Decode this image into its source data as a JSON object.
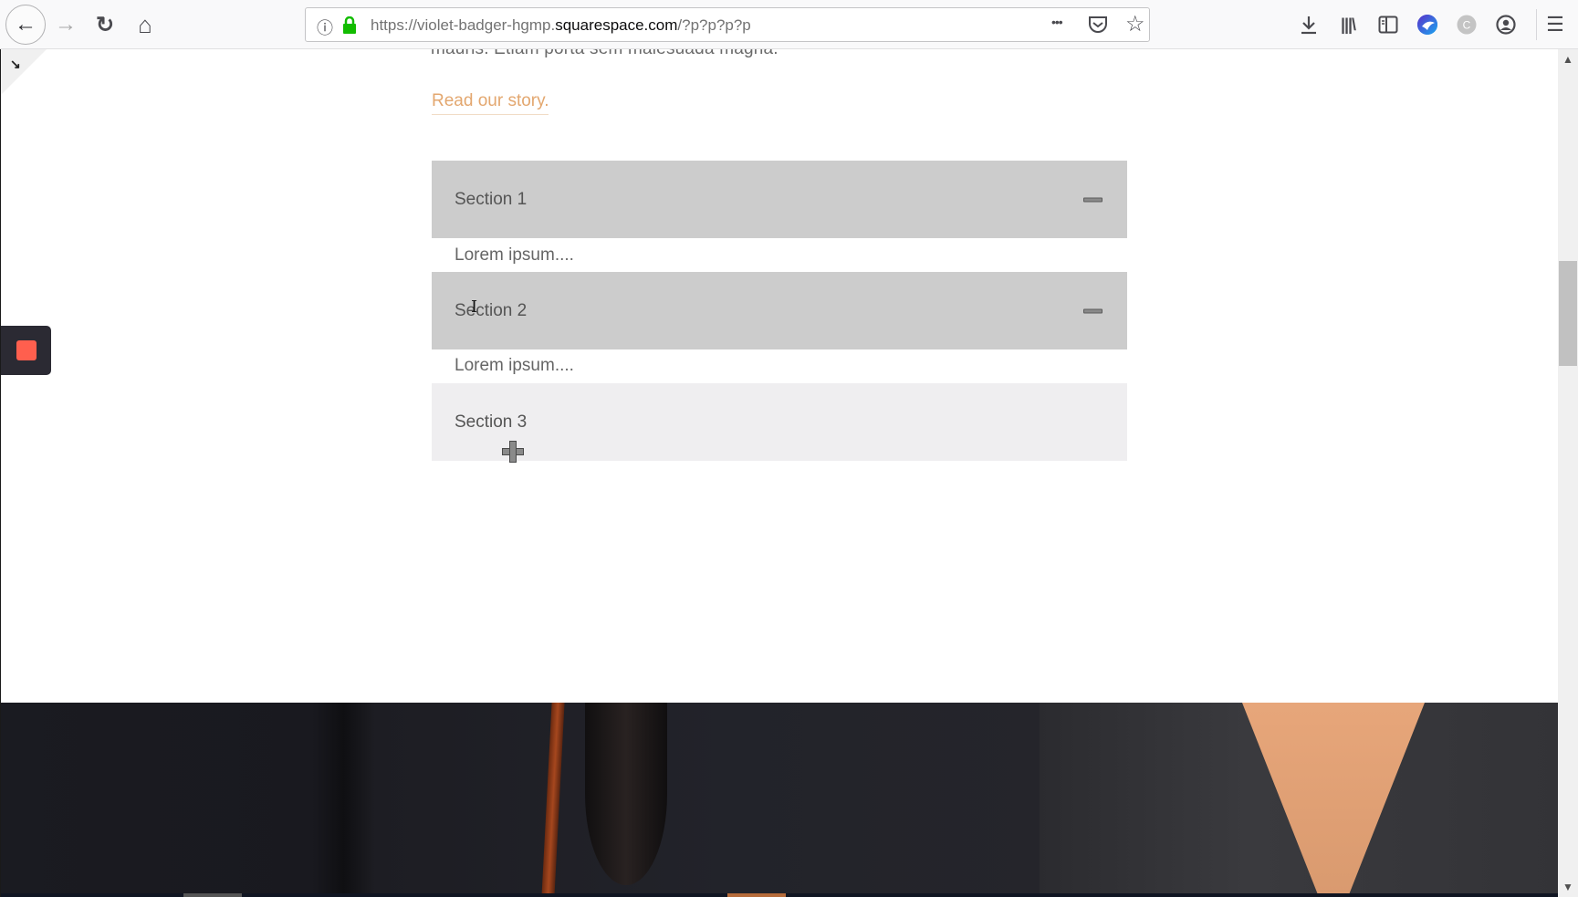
{
  "browser": {
    "url_prefix": "https://violet-badger-hgmp.",
    "url_host": "squarespace.com",
    "url_suffix": "/?p?p?p?p",
    "icons": {
      "back": "back-arrow-icon",
      "forward": "forward-arrow-icon",
      "reload": "reload-icon",
      "home": "home-icon",
      "info": "info-icon",
      "lock": "lock-icon",
      "more": "more-dots-icon",
      "pocket": "pocket-icon",
      "bookmark": "star-icon",
      "download": "download-icon",
      "library": "library-icon",
      "sidebar": "sidebar-icon",
      "extension1": "extension-icon",
      "extension2": "extension-c-icon",
      "account": "account-icon",
      "menu": "hamburger-menu-icon"
    },
    "glyphs": {
      "back": "←",
      "forward": "→",
      "reload": "↻",
      "home": "⌂",
      "info": "ⓘ",
      "more": "•••",
      "star": "☆",
      "download": "⤓",
      "library": "|||\\",
      "menu": "☰"
    }
  },
  "page": {
    "partial_text": "mauris. Etiam porta sem malesuada magna.",
    "read_link": "Read our story.",
    "accordion": [
      {
        "title": "Section 1",
        "state": "expanded",
        "body": "Lorem ipsum...."
      },
      {
        "title": "Section 2",
        "state": "expanded",
        "body": "Lorem ipsum...."
      },
      {
        "title": "Section 3",
        "state": "collapsed",
        "body": ""
      }
    ],
    "colors": {
      "link": "#e3a76f",
      "accordion_open": "#cccccc",
      "accordion_closed": "#efeef0",
      "record_button": "#ff5f4e"
    }
  },
  "widgets": {
    "corner_glyph": "↘",
    "record_label": "record-stop"
  },
  "scrollbar": {
    "up_glyph": "▲",
    "down_glyph": "▼"
  }
}
